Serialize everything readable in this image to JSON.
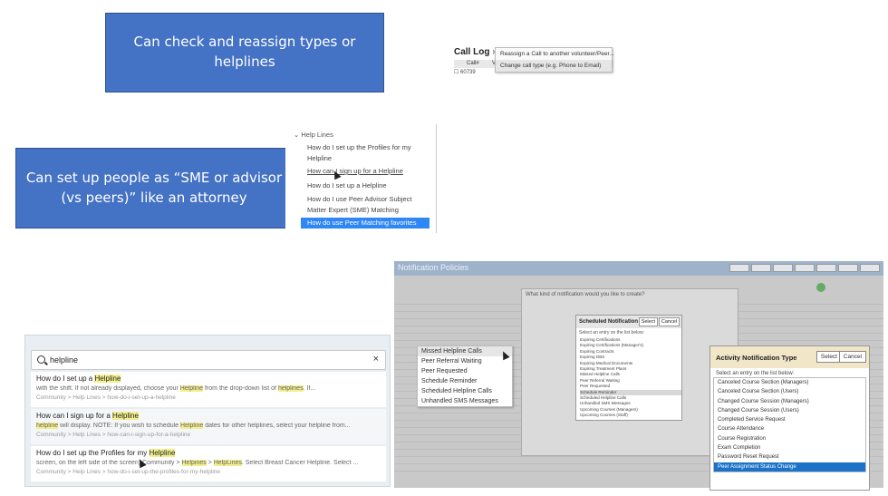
{
  "callouts": {
    "reassign": "Can check and reassign types or helplines",
    "sme": "Can set up people as “SME or advisor (vs peers)” like an attorney"
  },
  "call_log": {
    "title": "Call Log",
    "title_more": "Mo",
    "col_id": "Call#",
    "col_v": "V",
    "row_id": "60739",
    "menu": [
      "Reassign a Call to another volunteer/Peer...",
      "Change call type (e.g. Phone to Email)"
    ]
  },
  "help_nav": {
    "header": "Help Lines",
    "items": [
      "How do I set up the Profiles for my Helpline",
      "How can I sign up for a Helpline",
      "How do I set up a Helpline",
      "How do I use Peer Advisor Subject Matter Expert (SME) Matching"
    ],
    "selected": "How do use Peer Matching favorites"
  },
  "search": {
    "query": "helpline",
    "clear": "×",
    "results": [
      {
        "title_pre": "How do I set up a ",
        "title_mark": "Helpline",
        "snippet_pre": "with the shift. If not already displayed, choose your ",
        "snippet_mark1": "Helpline",
        "snippet_mid": " from the drop-down list of ",
        "snippet_mark2": "helplines",
        "snippet_post": ". If...",
        "path": "Community > Help Lines > how-do-i-set-up-a-helpline"
      },
      {
        "title_pre": "How can I sign up for a ",
        "title_mark": "Helpline",
        "snippet_pre": "",
        "snippet_mark1": "helpline",
        "snippet_mid": " will display. NOTE: If you wish to schedule ",
        "snippet_mark2": "Helpline",
        "snippet_post": " dates for other helplines, select your helpline from...",
        "path": "Community > Help Lines > how-can-i-sign-up-for-a-helpline"
      },
      {
        "title_pre": "How do I set up the Profiles for my ",
        "title_mark": "Helpline",
        "snippet_pre": "screen, on the left side of the screen) Community > ",
        "snippet_mark1": "Helpines",
        "snippet_mid": " > ",
        "snippet_mark2": "HelpLines",
        "snippet_post": ". Select Breast Cancer Helpline. Select ...",
        "path": "Community > Help Lines > how-do-i-set-up-the-profiles-for-my-helpline"
      }
    ]
  },
  "notification": {
    "title": "Notification Policies",
    "dialog_header": "What kind of notification would you like to create?"
  },
  "context_menu": [
    "Missed Helpline Calls",
    "Peer Referral Waiting",
    "Peer Requested",
    "Schedule Reminder",
    "Scheduled Helpline Calls",
    "Unhandled SMS Messages"
  ],
  "scheduled": {
    "title": "Scheduled Notification Type",
    "select": "Select",
    "cancel": "Cancel",
    "label": "Select an entry on the list below:",
    "items": [
      "Expiring Certifications",
      "Expiring Certifications (Manager's)",
      "Expiring Contracts",
      "Expiring DBS",
      "Expiring Medical Documents",
      "Expiring Treatment Plans",
      "Missed Helpline Calls",
      "Peer Referral Waiting",
      "Peer Requested",
      "Schedule Reminder",
      "Scheduled Helpline Calls",
      "Unhandled SMS Messages",
      "Upcoming Courses (Managers)",
      "Upcoming Courses (Staff)"
    ],
    "highlighted": "Schedule Reminder"
  },
  "activity": {
    "title": "Activity Notification Type",
    "select": "Select",
    "cancel": "Cancel",
    "label": "Select an entry on the list below:",
    "items": [
      "Canceled Course Section (Managers)",
      "Canceled Course Section (Users)",
      "Changed Course Session (Managers)",
      "Changed Course Session (Users)",
      "Completed Service Request",
      "Course Attendance",
      "Course Registration",
      "Exam Completion",
      "Password Reset Request"
    ],
    "selected": "Peer Assignment Status Change"
  }
}
